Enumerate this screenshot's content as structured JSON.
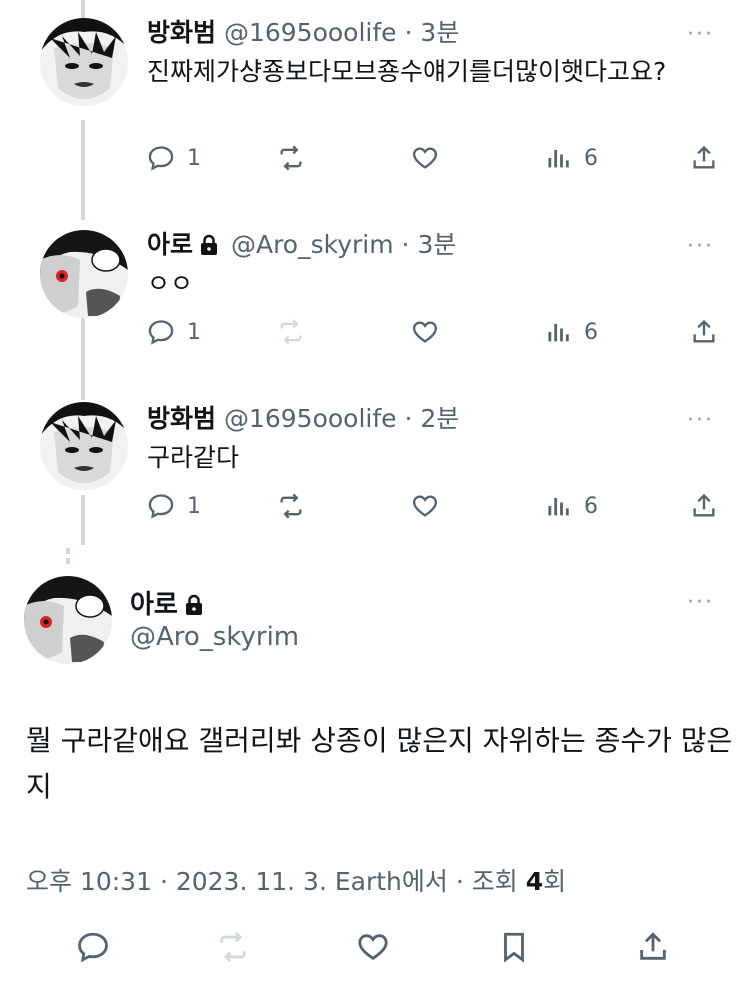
{
  "colors": {
    "text": "#0f1419",
    "secondary": "#536471",
    "divider": "#cfd9de"
  },
  "tweets": [
    {
      "name": "방화범",
      "handle": "@1695ooolife",
      "time": "· 3분",
      "locked": false,
      "text": "진짜제가샹죵보다모브죵수얘기를더많이햇다고요?",
      "replies": "1",
      "views": "6",
      "retweet_disabled": false
    },
    {
      "name": "아로",
      "handle": "@Aro_skyrim",
      "time": "· 3분",
      "locked": true,
      "text": "ㅇㅇ",
      "replies": "1",
      "views": "6",
      "retweet_disabled": true
    },
    {
      "name": "방화범",
      "handle": "@1695ooolife",
      "time": "· 2분",
      "locked": false,
      "text": "구라같다",
      "replies": "1",
      "views": "6",
      "retweet_disabled": false
    }
  ],
  "main": {
    "name": "아로",
    "handle": "@Aro_skyrim",
    "text": "뭘 구라같애요 갤러리봐 상종이 많은지 자위하는 종수가 많은지",
    "time": "오후 10:31 · 2023. 11. 3. Earth에서 · 조회",
    "views": "4",
    "views_suffix": "회"
  },
  "more_label": "···"
}
